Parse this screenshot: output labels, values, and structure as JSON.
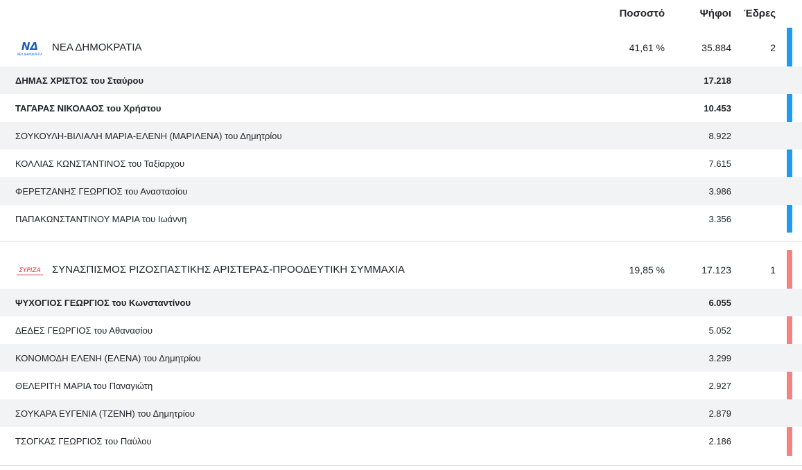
{
  "header": {
    "percentage_label": "Ποσοστό",
    "votes_label": "Ψήφοι",
    "seats_label": "Έδρες"
  },
  "parties": [
    {
      "logo_text": "ΝΔ",
      "logo_caption": "ΝΕΑ ΔΗΜΟΚΡΑΤΙΑ",
      "name": "ΝΕΑ ΔΗΜΟΚΡΑΤΙΑ",
      "percentage": "41,61 %",
      "votes": "35.884",
      "seats": "2",
      "color": "#1c9bf0",
      "candidates": [
        {
          "name": "ΔΗΜΑΣ ΧΡΙΣΤΟΣ του Σταύρου",
          "votes": "17.218",
          "elected": true
        },
        {
          "name": "ΤΑΓΑΡΑΣ ΝΙΚΟΛΑΟΣ του Χρήστου",
          "votes": "10.453",
          "elected": true
        },
        {
          "name": "ΣΟΥΚΟΥΛΗ-ΒΙΛΙΑΛΗ ΜΑΡΙΑ-ΕΛΕΝΗ (ΜΑΡΙΛΕΝΑ) του Δημητρίου",
          "votes": "8.922",
          "elected": false
        },
        {
          "name": "ΚΟΛΛΙΑΣ ΚΩΝΣΤΑΝΤΙΝΟΣ του Ταξίαρχου",
          "votes": "7.615",
          "elected": false
        },
        {
          "name": "ΦΕΡΕΤΖΑΝΗΣ ΓΕΩΡΓΙΟΣ του Αναστασίου",
          "votes": "3.986",
          "elected": false
        },
        {
          "name": "ΠΑΠΑΚΩΝΣΤΑΝΤΙΝΟΥ ΜΑΡΙΑ του Ιωάννη",
          "votes": "3.356",
          "elected": false
        }
      ]
    },
    {
      "logo_text": "ΣΥΡΙΖΑ",
      "name": "ΣΥΝΑΣΠΙΣΜΟΣ ΡΙΖΟΣΠΑΣΤΙΚΗΣ ΑΡΙΣΤΕΡΑΣ-ΠΡΟΟΔΕΥΤΙΚΗ ΣΥΜΜΑΧΙΑ",
      "percentage": "19,85 %",
      "votes": "17.123",
      "seats": "1",
      "color": "#f38383",
      "candidates": [
        {
          "name": "ΨΥΧΟΓΙΟΣ ΓΕΩΡΓΙΟΣ του Κωνσταντίνου",
          "votes": "6.055",
          "elected": true
        },
        {
          "name": "ΔΕΔΕΣ ΓΕΩΡΓΙΟΣ του Αθανασίου",
          "votes": "5.052",
          "elected": false
        },
        {
          "name": "ΚΟΝΟΜΟΔΗ ΕΛΕΝΗ (ΕΛΕΝΑ) του Δημητρίου",
          "votes": "3.299",
          "elected": false
        },
        {
          "name": "ΘΕΛΕΡΙΤΗ ΜΑΡΙΑ του Παναγιώτη",
          "votes": "2.927",
          "elected": false
        },
        {
          "name": "ΣΟΥΚΑΡΑ ΕΥΓΕΝΙΑ (ΤΖΕΝΗ) του Δημητρίου",
          "votes": "2.879",
          "elected": false
        },
        {
          "name": "ΤΣΟΓΚΑΣ ΓΕΩΡΓΙΟΣ του Παύλου",
          "votes": "2.186",
          "elected": false
        }
      ]
    }
  ]
}
